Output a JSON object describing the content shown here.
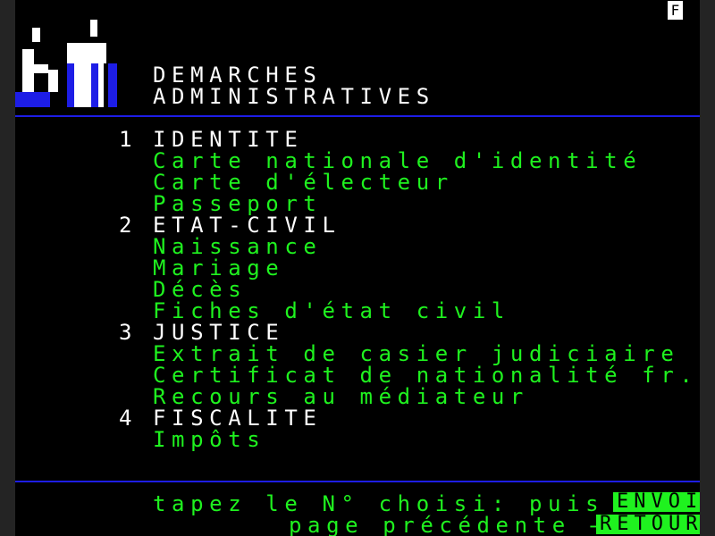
{
  "status": {
    "badge": "F"
  },
  "header": {
    "title_line1": "DEMARCHES",
    "title_line2": "ADMINISTRATIVES"
  },
  "menu": [
    {
      "number": "1",
      "heading": "IDENTITE",
      "items": [
        "Carte nationale d'identité",
        "Carte d'électeur",
        "Passeport"
      ]
    },
    {
      "number": "2",
      "heading": "ETAT-CIVIL",
      "items": [
        "Naissance",
        "Mariage",
        "Décès",
        "Fiches d'état civil"
      ]
    },
    {
      "number": "3",
      "heading": "JUSTICE",
      "items": [
        "Extrait de casier judiciaire",
        "Certificat de nationalité fr.",
        "Recours au médiateur"
      ]
    },
    {
      "number": "4",
      "heading": "FISCALITE",
      "items": [
        "Impôts"
      ]
    }
  ],
  "footer": {
    "prompt": "tapez le N° choisi: puis →",
    "envoi_key": "ENVOI",
    "back_prompt": "page précédente →",
    "retour_key": "RETOUR"
  },
  "colors": {
    "primary_text": "#ffffff",
    "item_text": "#1ff21f",
    "rule": "#1d1de6",
    "key_bg": "#1ff21f"
  }
}
